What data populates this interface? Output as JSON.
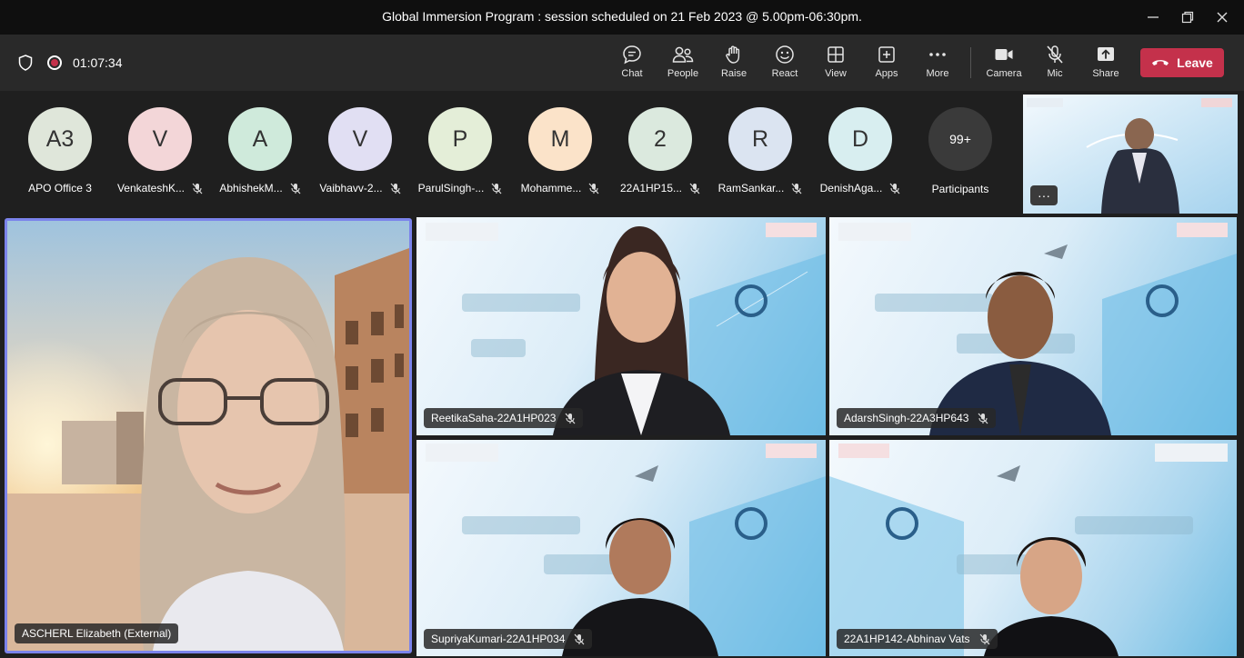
{
  "window": {
    "title": "Global Immersion Program : session scheduled on 21 Feb 2023 @ 5.00pm-06:30pm."
  },
  "toolbar": {
    "timer": "01:07:34",
    "buttons": [
      {
        "label": "Chat",
        "icon": "chat-icon"
      },
      {
        "label": "People",
        "icon": "people-icon"
      },
      {
        "label": "Raise",
        "icon": "raise-hand-icon"
      },
      {
        "label": "React",
        "icon": "react-icon"
      },
      {
        "label": "View",
        "icon": "view-icon"
      },
      {
        "label": "Apps",
        "icon": "apps-icon"
      },
      {
        "label": "More",
        "icon": "more-icon"
      },
      {
        "label": "Camera",
        "icon": "camera-icon"
      },
      {
        "label": "Mic",
        "icon": "mic-off-icon"
      },
      {
        "label": "Share",
        "icon": "share-icon"
      }
    ],
    "leave_label": "Leave",
    "leave_color": "#c4314b"
  },
  "participants": [
    {
      "initials": "A3",
      "name": "APO Office 3",
      "color": "#dfe6da"
    },
    {
      "initials": "V",
      "name": "VenkateshK...",
      "color": "#f3d6d8"
    },
    {
      "initials": "A",
      "name": "AbhishekM...",
      "color": "#cfeadb"
    },
    {
      "initials": "V",
      "name": "Vaibhavv-2...",
      "color": "#e1dff3"
    },
    {
      "initials": "P",
      "name": "ParulSingh-...",
      "color": "#e4eed8"
    },
    {
      "initials": "M",
      "name": "Mohamme...",
      "color": "#fbe3c9"
    },
    {
      "initials": "2",
      "name": "22A1HP15...",
      "color": "#dbe9de"
    },
    {
      "initials": "R",
      "name": "RamSankar...",
      "color": "#dbe4f1"
    },
    {
      "initials": "D",
      "name": "DenishAga...",
      "color": "#d8eef0"
    }
  ],
  "more_participants": {
    "count": "99+",
    "label": "Participants"
  },
  "tiles": [
    {
      "name": "ASCHERL Elizabeth (External)"
    },
    {
      "name": "ReetikaSaha-22A1HP023"
    },
    {
      "name": "AdarshSingh-22A3HP643"
    },
    {
      "name": "SupriyaKumari-22A1HP034"
    },
    {
      "name": "22A1HP142-Abhinav Vats"
    }
  ]
}
